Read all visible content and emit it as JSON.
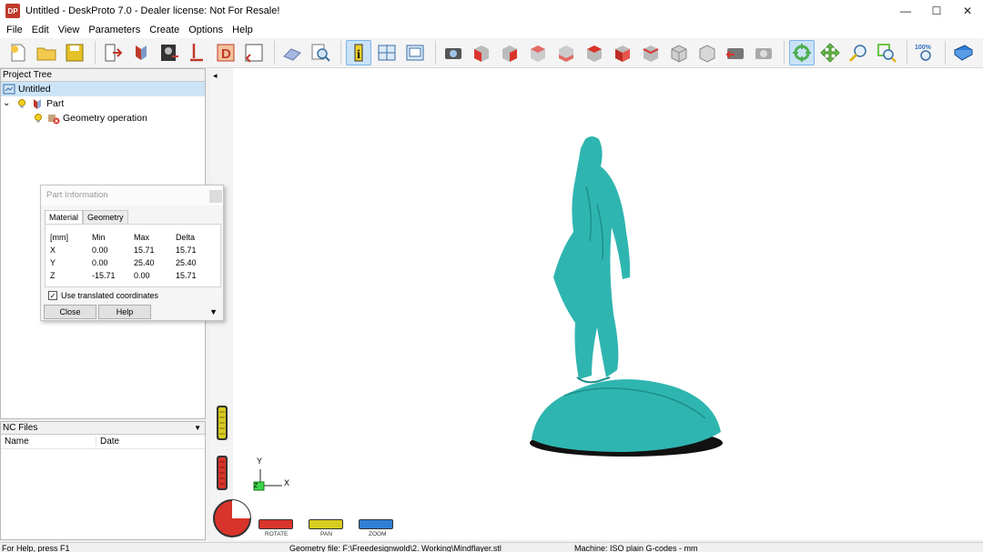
{
  "window": {
    "title": "Untitled - DeskProto 7.0 - Dealer license: Not For Resale!",
    "app_icon_text": "DP",
    "minimize_glyph": "—",
    "maximize_glyph": "☐",
    "close_glyph": "✕"
  },
  "menu": [
    "File",
    "Edit",
    "View",
    "Parameters",
    "Create",
    "Options",
    "Help"
  ],
  "toolbar": {
    "zoom_level": "100%"
  },
  "project_tree": {
    "header": "Project Tree",
    "items": [
      {
        "label": "Untitled",
        "level": 0
      },
      {
        "label": "Part",
        "level": 1
      },
      {
        "label": "Geometry operation",
        "level": 2
      }
    ],
    "expander_glyph": "⌄"
  },
  "nc_files": {
    "header": "NC Files",
    "columns": [
      "Name",
      "Date"
    ]
  },
  "part_info": {
    "title": "Part Information",
    "tabs": [
      "Material",
      "Geometry"
    ],
    "table": {
      "header": [
        "[mm]",
        "Min",
        "Max",
        "Delta"
      ],
      "rows": [
        [
          "X",
          "0.00",
          "15.71",
          "15.71"
        ],
        [
          "Y",
          "0.00",
          "25.40",
          "25.40"
        ],
        [
          "Z",
          "-15.71",
          "0.00",
          "15.71"
        ]
      ]
    },
    "checkbox_label": "Use translated coordinates",
    "checkbox_checked": true,
    "check_glyph": "✓",
    "close_label": "Close",
    "help_label": "Help",
    "expand_glyph": "▼"
  },
  "viewport": {
    "collapse_glyph": "◂",
    "axis_y": "Y",
    "axis_x": "X",
    "axis_z": "Z",
    "model_color": "#2fb5b0",
    "buttons": [
      {
        "label": "ROTATE",
        "color": "#d9342b"
      },
      {
        "label": "PAN",
        "color": "#d7cc1f"
      },
      {
        "label": "ZOOM",
        "color": "#2f7fd6"
      }
    ]
  },
  "status": {
    "help": "For Help, press F1",
    "geometry_file": "Geometry file: F:\\Freedesignwold\\2. Working\\Mindflayer.stl",
    "machine": "Machine: ISO plain G-codes - mm"
  }
}
